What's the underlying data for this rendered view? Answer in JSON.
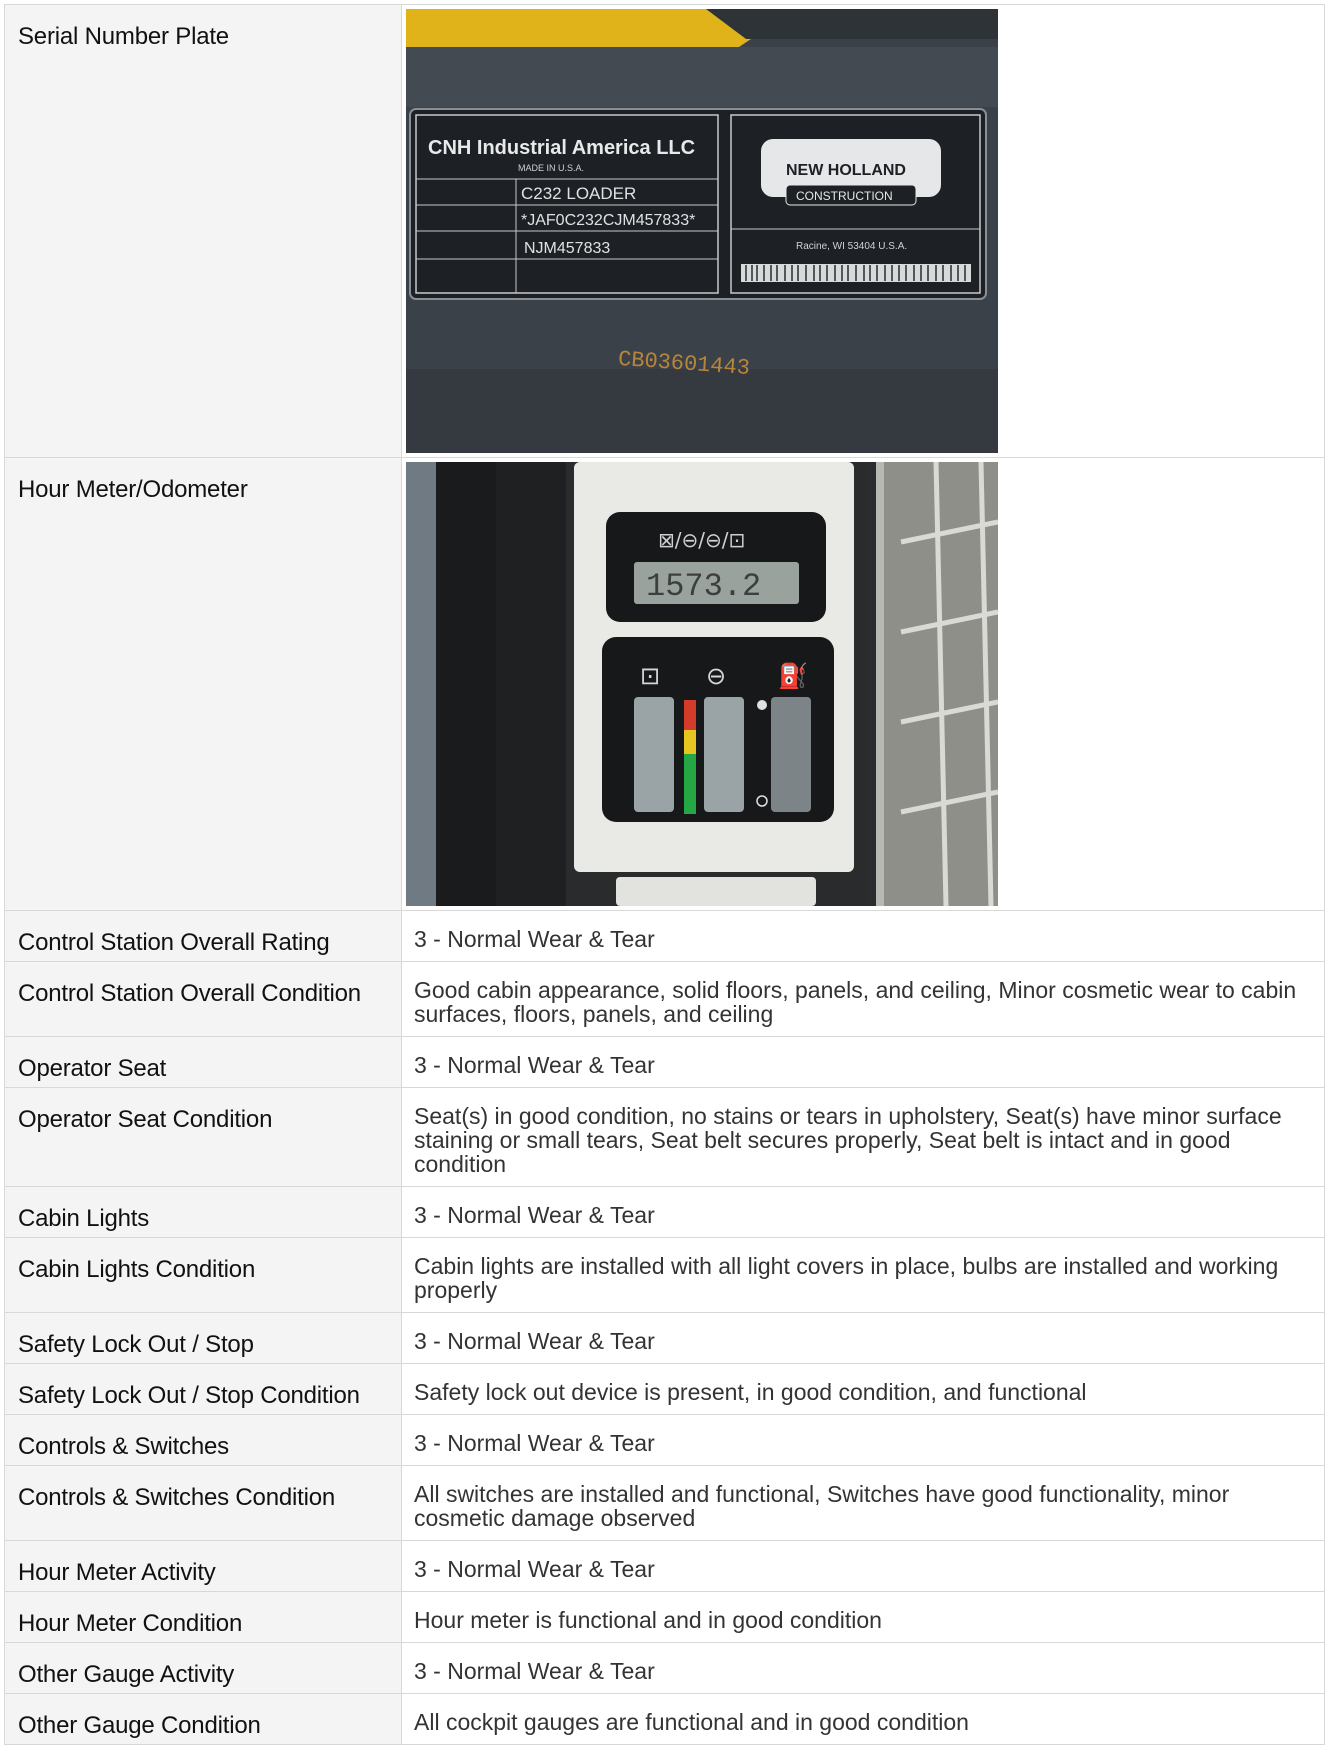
{
  "rows": [
    {
      "label": "Serial Number Plate",
      "type": "image",
      "image_name": "serial-number-plate-photo",
      "plate": {
        "company": "CNH Industrial America LLC",
        "made_in": "MADE IN U.S.A.",
        "model": "C232 LOADER",
        "pin": "*JAF0C232CJM457833*",
        "serial": "NJM457833",
        "brand": "NEW HOLLAND",
        "brand_sub": "CONSTRUCTION",
        "address": "Racine, WI 53404 U.S.A.",
        "stamp": "CB03601443"
      }
    },
    {
      "label": "Hour Meter/Odometer",
      "type": "image",
      "image_name": "hour-meter-photo",
      "meter": {
        "reading": "1573.2"
      }
    },
    {
      "label": "Control Station Overall Rating",
      "value": "3 - Normal Wear & Tear"
    },
    {
      "label": "Control Station Overall Condition",
      "value": "Good cabin appearance, solid floors, panels, and ceiling, Minor cosmetic wear to cabin surfaces, floors, panels, and ceiling"
    },
    {
      "label": "Operator Seat",
      "value": "3 - Normal Wear & Tear"
    },
    {
      "label": "Operator Seat Condition",
      "value": "Seat(s) in good condition, no stains or tears in upholstery, Seat(s) have minor surface staining or small tears, Seat belt secures properly, Seat belt is intact and in good condition"
    },
    {
      "label": "Cabin Lights",
      "value": "3 - Normal Wear & Tear"
    },
    {
      "label": "Cabin Lights Condition",
      "value": "Cabin lights are installed with all light covers in place, bulbs are installed and working properly"
    },
    {
      "label": "Safety Lock Out / Stop",
      "value": "3 - Normal Wear & Tear"
    },
    {
      "label": "Safety Lock Out / Stop Condition",
      "value": "Safety lock out device is present, in good condition, and functional"
    },
    {
      "label": "Controls & Switches",
      "value": "3 - Normal Wear & Tear"
    },
    {
      "label": "Controls & Switches Condition",
      "value": "All switches are installed and functional, Switches have good functionality, minor cosmetic damage observed"
    },
    {
      "label": "Hour Meter Activity",
      "value": "3 - Normal Wear & Tear"
    },
    {
      "label": "Hour Meter Condition",
      "value": "Hour meter is functional and in good condition"
    },
    {
      "label": "Other Gauge Activity",
      "value": "3 - Normal Wear & Tear"
    },
    {
      "label": "Other Gauge Condition",
      "value": "All cockpit gauges are functional and in good condition"
    }
  ]
}
